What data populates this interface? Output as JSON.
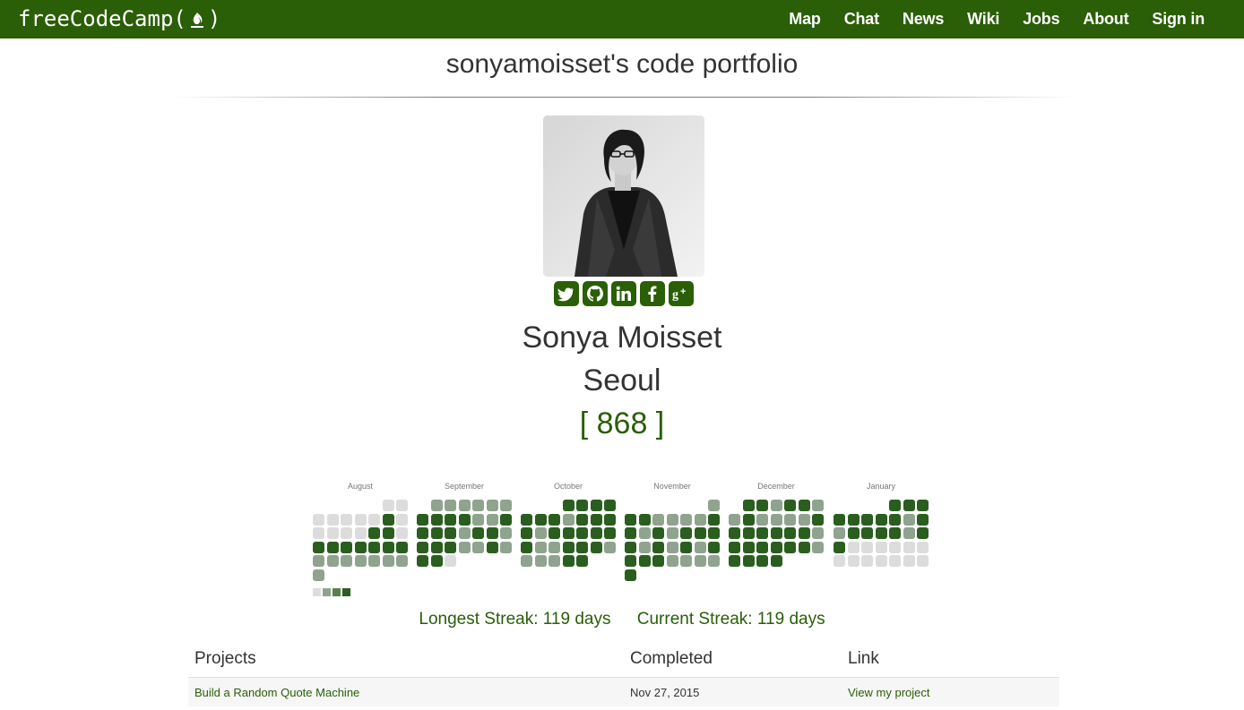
{
  "navbar": {
    "brand": "freeCodeCamp(",
    "brand_close": ")",
    "links": [
      "Map",
      "Chat",
      "News",
      "Wiki",
      "Jobs",
      "About",
      "Sign in"
    ]
  },
  "page_title": "sonyamoisset's code portfolio",
  "profile": {
    "name": "Sonya Moisset",
    "city": "Seoul",
    "points": "[ 868 ]",
    "social": [
      "twitter-icon",
      "github-icon",
      "linkedin-icon",
      "facebook-icon",
      "google-plus-icon"
    ]
  },
  "heatmap": {
    "months": [
      "August",
      "September",
      "October",
      "November",
      "December",
      "January"
    ],
    "colors": {
      "empty": "#dcdcdc",
      "light": "#8fa38f",
      "medium": "#5c7f4f",
      "dark": "#2a5e1e"
    }
  },
  "streaks": {
    "longest": "Longest Streak: 119 days",
    "current": "Current Streak: 119 days"
  },
  "table": {
    "headers": [
      "Projects",
      "Completed",
      "Link"
    ],
    "rows": [
      {
        "project": "Build a Random Quote Machine",
        "completed": "Nov 27, 2015",
        "link": "View my project"
      }
    ]
  },
  "colors": {
    "brand_green": "#2a5e07"
  }
}
